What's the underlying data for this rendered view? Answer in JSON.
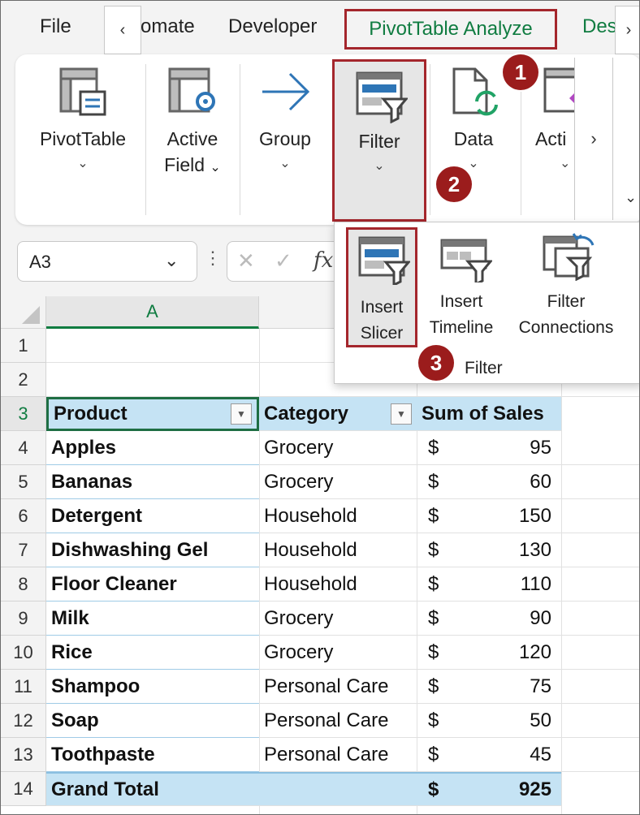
{
  "tabs": {
    "file": "File",
    "automate": "omate",
    "developer": "Developer",
    "pivot": "PivotTable Analyze",
    "design": "Des",
    "scroll_left": "‹",
    "scroll_right": "›"
  },
  "ribbon": {
    "pivottable": "PivotTable",
    "active_field_1": "Active",
    "active_field_2": "Field",
    "group": "Group",
    "filter": "Filter",
    "data": "Data",
    "actions": "Acti",
    "more": "›"
  },
  "formula_bar": {
    "name_box": "A3",
    "fx": "fx"
  },
  "filter_menu": {
    "insert_slicer_1": "Insert",
    "insert_slicer_2": "Slicer",
    "insert_timeline_1": "Insert",
    "insert_timeline_2": "Timeline",
    "filter_connections_1": "Filter",
    "filter_connections_2": "Connections",
    "group_label": "Filter"
  },
  "badges": [
    "1",
    "2",
    "3"
  ],
  "sheet": {
    "col_a": "A",
    "row_numbers": [
      "1",
      "2",
      "3",
      "4",
      "5",
      "6",
      "7",
      "8",
      "9",
      "10",
      "11",
      "12",
      "13",
      "14"
    ],
    "headers": [
      "Product",
      "Category",
      "Sum of Sales"
    ],
    "rows": [
      {
        "product": "Apples",
        "category": "Grocery",
        "cur": "$",
        "value": "95"
      },
      {
        "product": "Bananas",
        "category": "Grocery",
        "cur": "$",
        "value": "60"
      },
      {
        "product": "Detergent",
        "category": "Household",
        "cur": "$",
        "value": "150"
      },
      {
        "product": "Dishwashing Gel",
        "category": "Household",
        "cur": "$",
        "value": "130"
      },
      {
        "product": "Floor Cleaner",
        "category": "Household",
        "cur": "$",
        "value": "110"
      },
      {
        "product": "Milk",
        "category": "Grocery",
        "cur": "$",
        "value": "90"
      },
      {
        "product": "Rice",
        "category": "Grocery",
        "cur": "$",
        "value": "120"
      },
      {
        "product": "Shampoo",
        "category": "Personal Care",
        "cur": "$",
        "value": "75"
      },
      {
        "product": "Soap",
        "category": "Personal Care",
        "cur": "$",
        "value": "50"
      },
      {
        "product": "Toothpaste",
        "category": "Personal Care",
        "cur": "$",
        "value": "45"
      }
    ],
    "total": {
      "label": "Grand Total",
      "cur": "$",
      "value": "925"
    }
  },
  "colors": {
    "accent_red": "#a4262c",
    "excel_green": "#107c41",
    "pivot_header_blue": "#c5e3f4"
  }
}
